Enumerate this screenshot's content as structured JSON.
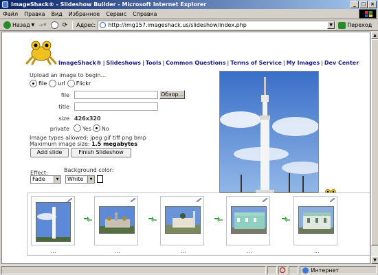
{
  "window": {
    "title": "ImageShack® - Slideshow Builder - Microsoft Internet Explorer"
  },
  "menu": [
    "Файл",
    "Правка",
    "Вид",
    "Избранное",
    "Сервис",
    "Справка"
  ],
  "toolbar": {
    "back_label": "Назад",
    "address_label": "Адрес:",
    "url": "http://img157.imageshack.us/slideshow/index.php",
    "go_label": "Переход"
  },
  "nav": {
    "items": [
      "ImageShack®",
      "Slideshows",
      "Tools",
      "Common Questions",
      "Terms of Service",
      "My Images",
      "Dev Center"
    ]
  },
  "upload": {
    "heading": "Upload an image to begin...",
    "source_options": [
      "file",
      "url",
      "Flickr"
    ],
    "selected_source": "file",
    "file_label": "file",
    "browse_label": "Обзор...",
    "title_label": "title",
    "size_label": "size",
    "size_value": "426x320",
    "private_label": "private",
    "private_options": [
      "Yes",
      "No"
    ],
    "private_selected": "No",
    "types_text": "Image types allowed: jpeg gif tiff png bmp",
    "max_size_prefix": "Maximum image size:",
    "max_size_value": "1.5 megabytes",
    "add_slide_label": "Add slide",
    "finish_label": "Finish Slideshow"
  },
  "effect": {
    "label": "Effect:",
    "value": "Fade"
  },
  "background": {
    "label": "Background color:",
    "value": "White"
  },
  "slides": {
    "captions": [
      "...",
      "...",
      "...",
      "...",
      "..."
    ]
  },
  "status": {
    "zone": "Интернет"
  },
  "colors": {
    "nav_link": "#1a1a8a",
    "title_bar": "#0a246a",
    "frog_yellow": "#f0c020"
  }
}
